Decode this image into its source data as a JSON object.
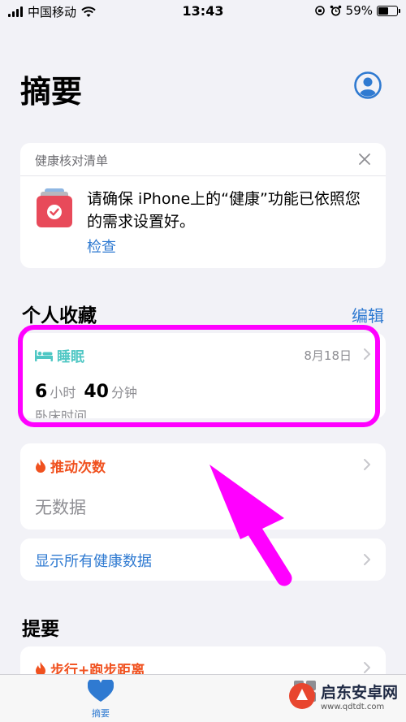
{
  "status_bar": {
    "carrier": "中国移动",
    "time": "13:43",
    "battery": "59%",
    "battery_level": 0.59
  },
  "header": {
    "title": "摘要"
  },
  "checklist": {
    "title": "健康核对清单",
    "message": "请确保 iPhone上的“健康”功能已依照您的需求设置好。",
    "link": "检查"
  },
  "favorites": {
    "title": "个人收藏",
    "edit": "编辑",
    "sleep": {
      "label": "睡眠",
      "date": "8月18日",
      "hours": "6",
      "hours_unit": "小时",
      "minutes": "40",
      "minutes_unit": "分钟",
      "caption": "卧床时间",
      "color": "#4fc7c4"
    },
    "flights": {
      "label": "推动次数",
      "value": "无数据",
      "color": "#f0511f"
    },
    "show_all": "显示所有健康数据"
  },
  "highlights": {
    "title": "提要",
    "item": "步行+跑步距离"
  },
  "tab_bar": {
    "summary": "摘要"
  },
  "watermark": {
    "text": "启东安卓网",
    "url": "www.qdtdt.com"
  },
  "colors": {
    "accent": "#2f7ad1",
    "annotation": "#ff00ff",
    "heart": "#2f7ad1"
  }
}
